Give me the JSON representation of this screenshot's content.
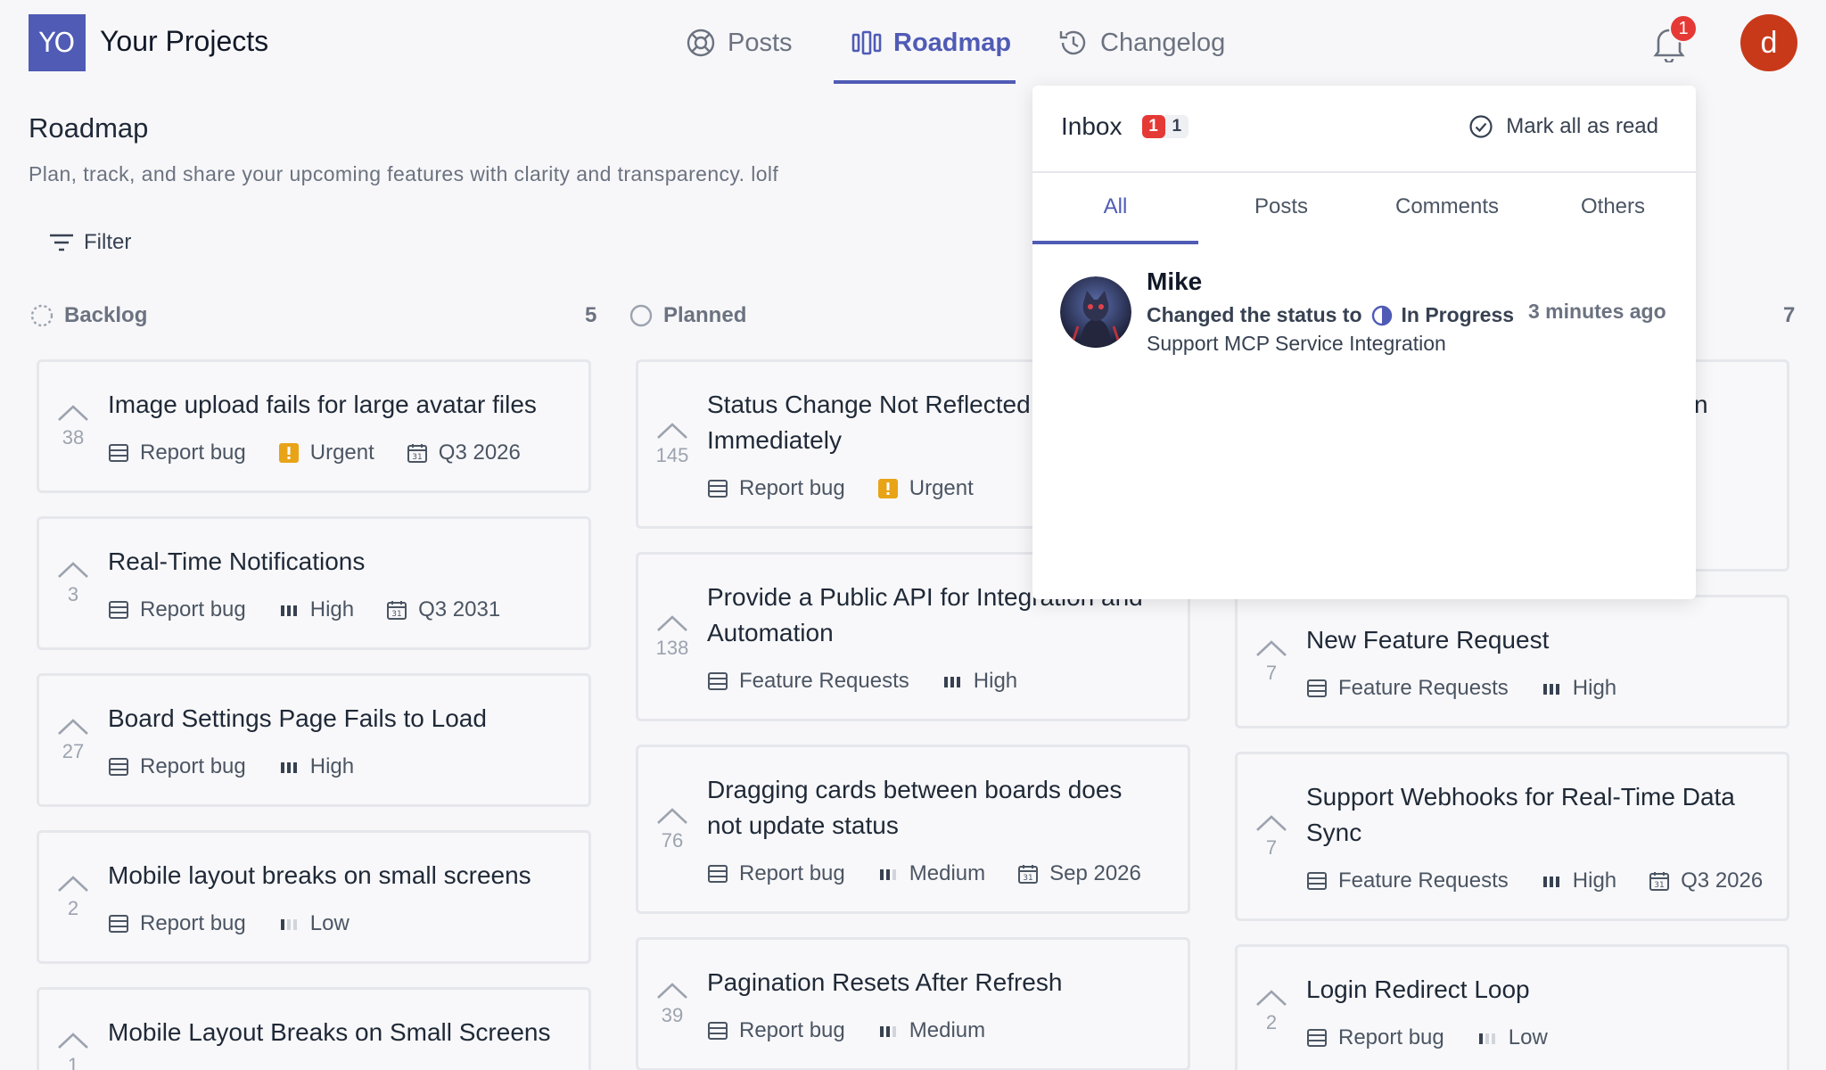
{
  "header": {
    "logo_initials": "YO",
    "project_name": "Your Projects",
    "nav": [
      {
        "label": "Posts",
        "icon": "lifebuoy-icon"
      },
      {
        "label": "Roadmap",
        "icon": "columns-icon",
        "active": true
      },
      {
        "label": "Changelog",
        "icon": "history-icon"
      }
    ],
    "notification_count": "1",
    "user_initial": "d"
  },
  "page": {
    "title": "Roadmap",
    "description": "Plan, track, and share your upcoming features with clarity and transparency. lolf",
    "filter_label": "Filter"
  },
  "columns": [
    {
      "name": "Backlog",
      "count": "5",
      "cards": [
        {
          "votes": "38",
          "title_lines": [
            "Image upload fails for large avatar files"
          ],
          "category": "Report bug",
          "priority": "Urgent",
          "date": "Q3 2026"
        },
        {
          "votes": "3",
          "title_lines": [
            "Real-Time Notifications"
          ],
          "category": "Report bug",
          "priority": "High",
          "date": "Q3 2031"
        },
        {
          "votes": "27",
          "title_lines": [
            "Board Settings Page Fails to Load"
          ],
          "category": "Report bug",
          "priority": "High",
          "date": ""
        },
        {
          "votes": "2",
          "title_lines": [
            "Mobile layout breaks on small screens"
          ],
          "category": "Report bug",
          "priority": "Low",
          "date": ""
        },
        {
          "votes": "1",
          "title_lines": [
            "Mobile Layout Breaks on Small Screens"
          ],
          "category": "",
          "priority": "",
          "date": ""
        }
      ]
    },
    {
      "name": "Planned",
      "count": "",
      "cards": [
        {
          "votes": "145",
          "title_lines": [
            "Status Change Not Reflected",
            "Immediately"
          ],
          "category": "Report bug",
          "priority": "Urgent",
          "date": ""
        },
        {
          "votes": "138",
          "title_lines": [
            "Provide a Public API for Integration and",
            "Automation"
          ],
          "category": "Feature Requests",
          "priority": "High",
          "date": ""
        },
        {
          "votes": "76",
          "title_lines": [
            "Dragging cards between boards does",
            "not update status"
          ],
          "category": "Report bug",
          "priority": "Medium",
          "date": "Sep 2026"
        },
        {
          "votes": "39",
          "title_lines": [
            "Pagination Resets After Refresh"
          ],
          "category": "Report bug",
          "priority": "Medium",
          "date": ""
        }
      ]
    },
    {
      "name": "",
      "count": "7",
      "partial_title_fragment": "n",
      "cards": [
        {
          "votes": "7",
          "title_lines": [
            "New Feature Request"
          ],
          "category": "Feature Requests",
          "priority": "High",
          "date": ""
        },
        {
          "votes": "7",
          "title_lines": [
            "Support Webhooks for Real-Time Data",
            "Sync"
          ],
          "category": "Feature Requests",
          "priority": "High",
          "date": "Q3 2026"
        },
        {
          "votes": "2",
          "title_lines": [
            "Login Redirect Loop"
          ],
          "category": "Report bug",
          "priority": "Low",
          "date": ""
        }
      ]
    }
  ],
  "inbox": {
    "title": "Inbox",
    "unread_count": "1",
    "total_count": "1",
    "mark_all_label": "Mark all as read",
    "tabs": [
      "All",
      "Posts",
      "Comments",
      "Others"
    ],
    "active_tab": "All",
    "notifications": [
      {
        "user": "Mike",
        "action": "Changed the status to",
        "status": "In Progress",
        "time": "3 minutes ago",
        "target": "Support MCP Service Integration"
      }
    ]
  },
  "colors": {
    "accent": "#4f5bb5",
    "urgent": "#e8a317",
    "badge": "#e53935",
    "avatar": "#c8391a"
  }
}
